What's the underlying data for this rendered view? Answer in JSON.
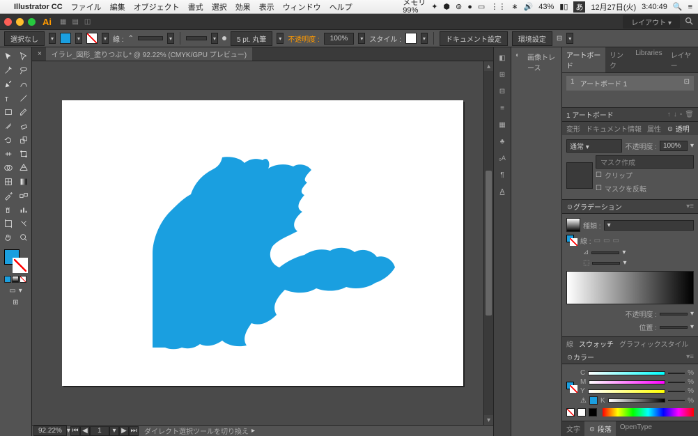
{
  "menubar": {
    "app": "Illustrator CC",
    "items": [
      "ファイル",
      "編集",
      "オブジェクト",
      "書式",
      "選択",
      "効果",
      "表示",
      "ウィンドウ",
      "ヘルプ"
    ],
    "right": {
      "memory_lbl": "メモリ",
      "memory_pct": "99%",
      "battery": "43%",
      "ime": "あ",
      "date": "12月27日(火)",
      "time": "3:40:49"
    }
  },
  "titlebar": {
    "layout_label": "レイアウト"
  },
  "ctrl": {
    "no_selection": "選択なし",
    "stroke_lbl": "線 :",
    "stroke_weight_field": "",
    "stroke_style": "5 pt. 丸筆",
    "opacity_lbl": "不透明度 :",
    "opacity_val": "100%",
    "style_lbl": "スタイル :",
    "doc_setup": "ドキュメント設定",
    "prefs": "環境設定"
  },
  "document": {
    "tab": "イラレ_図形_塗りつぶし* @ 92.22% (CMYK/GPU プレビュー)",
    "zoom": "92.22%",
    "status": "ダイレクト選択ツールを切り換え"
  },
  "midpanel": {
    "image_trace": "画像トレース"
  },
  "panels": {
    "artboards": {
      "tabs": [
        "アートボード",
        "リンク",
        "Libraries",
        "レイヤー"
      ],
      "item_num": "1",
      "item_name": "アートボード 1",
      "count": "1 アートボード"
    },
    "transparency": {
      "tabs": [
        "変形",
        "ドキュメント情報",
        "属性",
        "☉ 透明"
      ],
      "blend": "通常",
      "opacity_lbl": "不透明度 :",
      "opacity_val": "100%",
      "make_mask": "マスク作成",
      "clip": "クリップ",
      "invert": "マスクを反転"
    },
    "gradient": {
      "title": "☉グラデーション",
      "type_lbl": "種類 :",
      "stroke_lbl": "線 :",
      "angle_field": "",
      "ratio_field": "",
      "opacity_lbl": "不透明度 :",
      "location_lbl": "位置 :"
    },
    "swatches": {
      "tabs": [
        "線",
        "スウォッチ",
        "グラフィックスタイル"
      ]
    },
    "color": {
      "title": "☉カラー",
      "c": "C",
      "m": "M",
      "y": "Y",
      "k": "K",
      "pct": "%"
    },
    "footer": {
      "tabs": [
        "文字",
        "☉ 段落",
        "OpenType"
      ]
    }
  }
}
